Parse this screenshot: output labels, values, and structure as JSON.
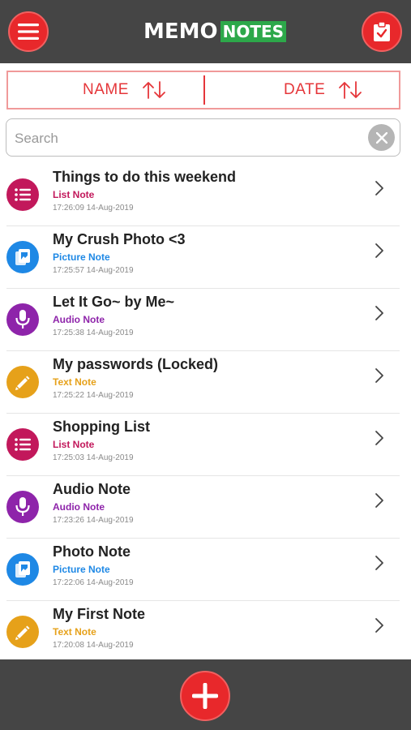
{
  "header": {
    "logo_memo": "MEMO",
    "logo_notes": "NOTES"
  },
  "sort": {
    "name_label": "NAME",
    "date_label": "DATE"
  },
  "search": {
    "placeholder": "Search",
    "value": ""
  },
  "notes": [
    {
      "title": "Things to do this weekend",
      "type": "List Note",
      "time": "17:26:09 14-Aug-2019",
      "icon": "list-icon"
    },
    {
      "title": "My Crush Photo <3",
      "type": "Picture Note",
      "time": "17:25:57 14-Aug-2019",
      "icon": "picture-icon"
    },
    {
      "title": "Let It Go~ by Me~",
      "type": "Audio Note",
      "time": "17:25:38 14-Aug-2019",
      "icon": "microphone-icon"
    },
    {
      "title": "My passwords (Locked)",
      "type": "Text Note",
      "time": "17:25:22 14-Aug-2019",
      "icon": "pencil-icon"
    },
    {
      "title": "Shopping List",
      "type": "List Note",
      "time": "17:25:03 14-Aug-2019",
      "icon": "list-icon"
    },
    {
      "title": "Audio Note",
      "type": "Audio Note",
      "time": "17:23:26 14-Aug-2019",
      "icon": "microphone-icon"
    },
    {
      "title": "Photo Note",
      "type": "Picture Note",
      "time": "17:22:06 14-Aug-2019",
      "icon": "picture-icon"
    },
    {
      "title": "My First Note",
      "type": "Text Note",
      "time": "17:20:08 14-Aug-2019",
      "icon": "pencil-icon"
    }
  ],
  "colors": {
    "accent_red": "#e8282b",
    "bar_gray": "#454545",
    "list_note": "#c2185b",
    "picture_note": "#1e88e5",
    "audio_note": "#8e24aa",
    "text_note": "#e6a11a",
    "logo_green": "#2da84a"
  }
}
